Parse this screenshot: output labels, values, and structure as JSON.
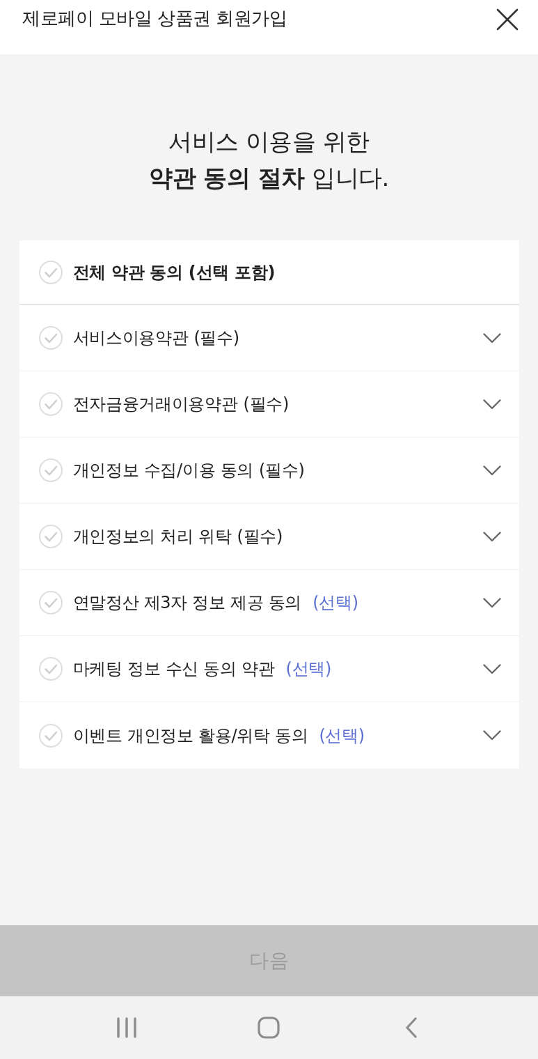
{
  "header": {
    "title": "제로페이 모바일 상품권 회원가입"
  },
  "heading": {
    "lines": [
      "서비스 이용을 위한",
      "**약관 동의 절차** 입니다."
    ]
  },
  "agree_all": {
    "label": "전체 약관 동의 (선택 포함)",
    "checked": false
  },
  "items": [
    {
      "title": "서비스이용약관",
      "tag": "(필수)",
      "kind": "required",
      "checked": false,
      "expanded": false
    },
    {
      "title": "전자금융거래이용약관",
      "tag": "(필수)",
      "kind": "required",
      "checked": false,
      "expanded": false
    },
    {
      "title": "개인정보 수집/이용 동의",
      "tag": "(필수)",
      "kind": "required",
      "checked": false,
      "expanded": false
    },
    {
      "title": "개인정보의 처리 위탁",
      "tag": "(필수)",
      "kind": "required",
      "checked": false,
      "expanded": false
    },
    {
      "title": "연말정산 제3자 정보 제공 동의",
      "tag": "(선택)",
      "kind": "optional",
      "checked": false,
      "expanded": false
    },
    {
      "title": "마케팅 정보 수신 동의 약관",
      "tag": "(선택)",
      "kind": "optional",
      "checked": false,
      "expanded": false
    },
    {
      "title": "이벤트 개인정보 활용/위탁 동의",
      "tag": "(선택)",
      "kind": "optional",
      "checked": false,
      "expanded": false
    }
  ],
  "next_button": {
    "label": "다음",
    "disabled": true
  }
}
